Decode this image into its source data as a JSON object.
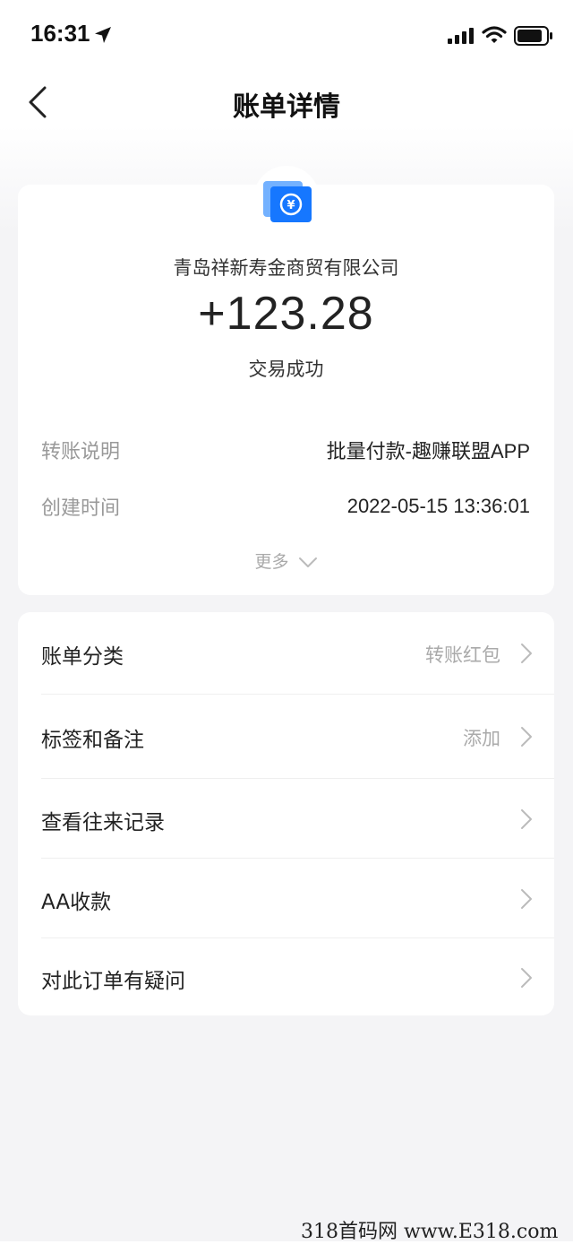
{
  "status_bar": {
    "time": "16:31"
  },
  "header": {
    "title": "账单详情"
  },
  "summary": {
    "merchant": "青岛祥新寿金商贸有限公司",
    "amount": "+123.28",
    "status": "交易成功",
    "details": [
      {
        "label": "转账说明",
        "value": "批量付款-趣赚联盟APP"
      },
      {
        "label": "创建时间",
        "value": "2022-05-15 13:36:01"
      }
    ],
    "more_label": "更多"
  },
  "actions": [
    {
      "label": "账单分类",
      "value": "转账红包"
    },
    {
      "label": "标签和备注",
      "value": "添加"
    },
    {
      "label": "查看往来记录",
      "value": ""
    },
    {
      "label": "AA收款",
      "value": ""
    },
    {
      "label": "对此订单有疑问",
      "value": ""
    }
  ],
  "watermark": "318首码网 www.E318.com",
  "colors": {
    "accent_blue": "#1677ff",
    "muted_text": "#999999",
    "background": "#f4f4f6"
  }
}
